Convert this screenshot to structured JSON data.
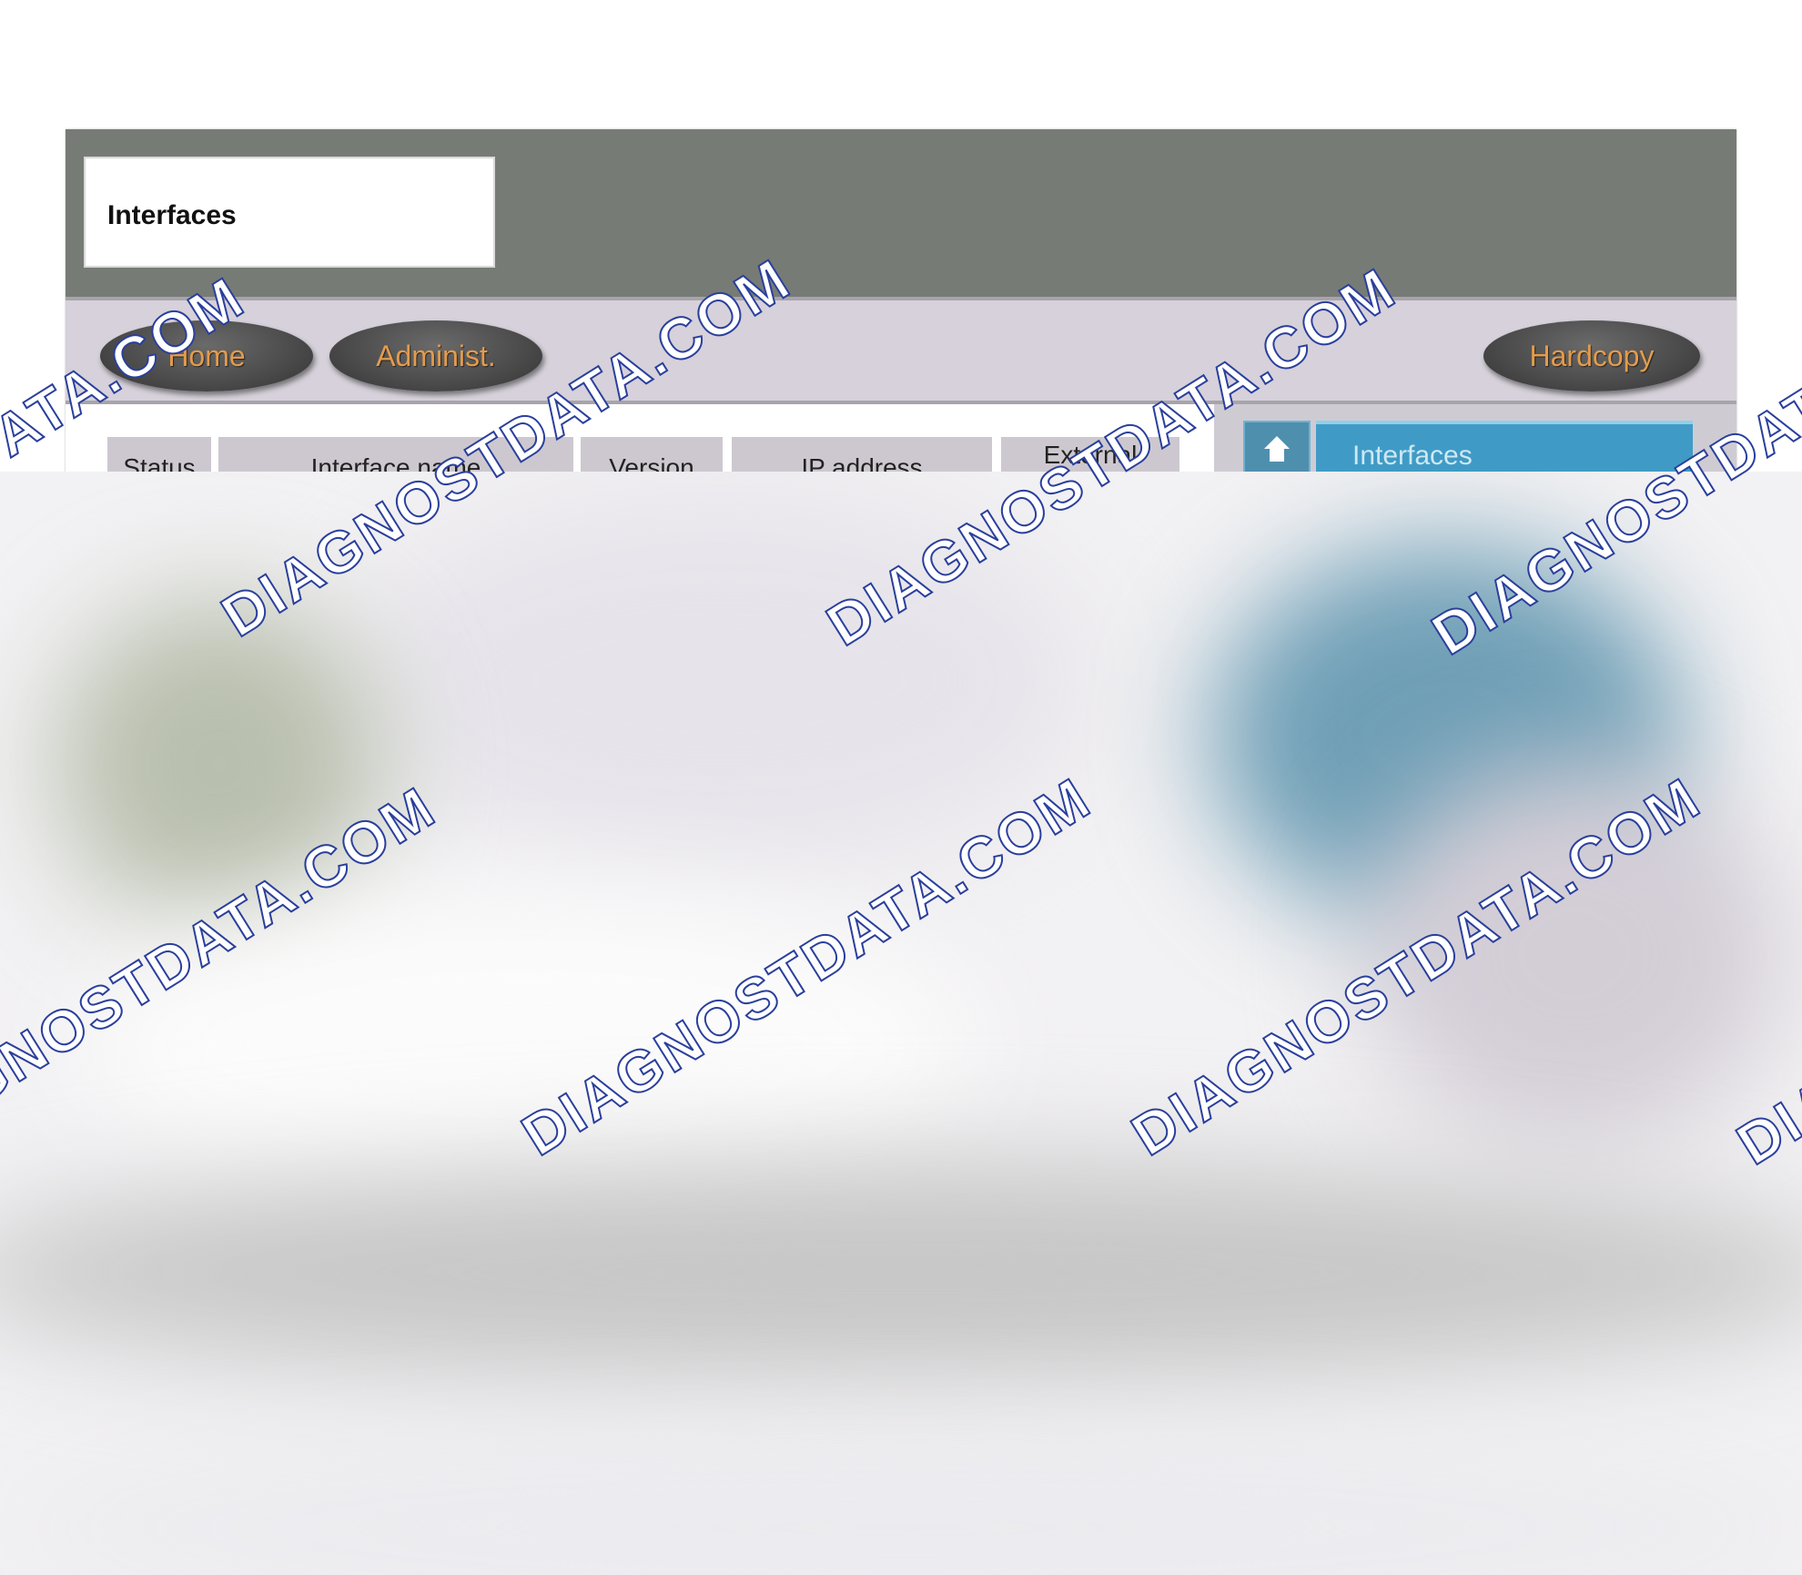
{
  "window": {
    "title": "Interfaces"
  },
  "nav": {
    "home_label": "Home",
    "admin_label": "Administ.",
    "hardcopy_label": "Hardcopy",
    "button_text_color": "#e39b4c"
  },
  "table": {
    "columns": [
      "Status",
      "Interface name",
      "Version",
      "IP address",
      "External"
    ]
  },
  "side_panel": {
    "title": "Interfaces",
    "icon": "home-icon",
    "accent_color": "#3f9bc6"
  },
  "watermark": {
    "text": "DIAGNOSTDATA.COM"
  }
}
